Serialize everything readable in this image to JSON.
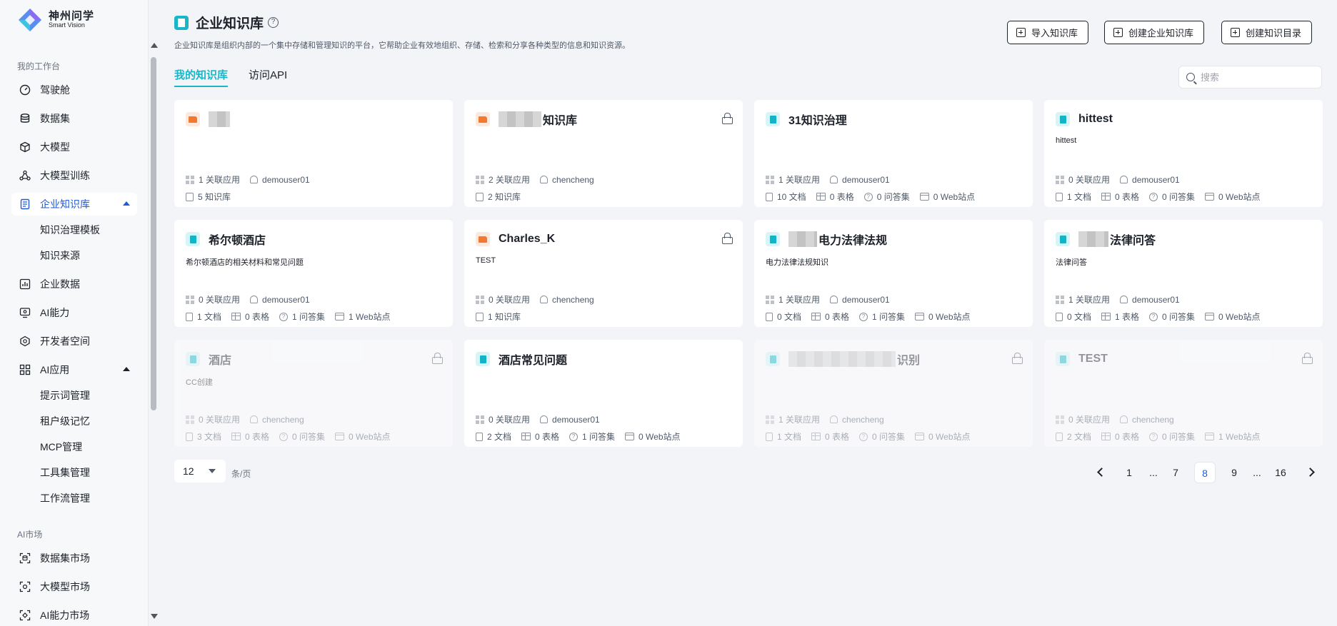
{
  "brand": {
    "name_cn": "神州问学",
    "name_en": "Smart Vision"
  },
  "sidebar": {
    "group_workspace": "我的工作台",
    "items": [
      {
        "label": "驾驶舱",
        "icon": "dashboard-icon"
      },
      {
        "label": "数据集",
        "icon": "database-icon"
      },
      {
        "label": "大模型",
        "icon": "cube-icon"
      },
      {
        "label": "大模型训练",
        "icon": "training-icon"
      },
      {
        "label": "企业知识库",
        "icon": "knowledge-icon",
        "active": true
      },
      {
        "label": "企业数据",
        "icon": "chart-icon"
      },
      {
        "label": "AI能力",
        "icon": "ai-monitor-icon"
      },
      {
        "label": "开发者空间",
        "icon": "developer-icon"
      },
      {
        "label": "AI应用",
        "icon": "grid-icon"
      }
    ],
    "knowledge_sub": [
      "知识治理模板",
      "知识来源"
    ],
    "app_sub": [
      "提示词管理",
      "租户级记忆",
      "MCP管理",
      "工具集管理",
      "工作流管理"
    ],
    "group_market": "AI市场",
    "market_items": [
      "数据集市场",
      "大模型市场",
      "AI能力市场"
    ]
  },
  "header": {
    "title": "企业知识库",
    "help": "?",
    "description": "企业知识库是组织内部的一个集中存储和管理知识的平台，它帮助企业有效地组织、存储、检索和分享各种类型的信息和知识资源。",
    "buttons": {
      "import": "导入知识库",
      "create_kb": "创建企业知识库",
      "create_dir": "创建知识目录"
    }
  },
  "tabs": {
    "mine": "我的知识库",
    "api": "访问API"
  },
  "search": {
    "placeholder": "搜索"
  },
  "cards": [
    {
      "title": "",
      "desc": "",
      "apps": "1 关联应用",
      "owner": "demouser01",
      "docs": "",
      "tables": "",
      "qa": "",
      "web": "",
      "kb": "5 知识库"
    },
    {
      "title": "知识库",
      "desc": "",
      "apps": "2 关联应用",
      "owner": "chencheng",
      "docs": "",
      "tables": "",
      "qa": "",
      "web": "",
      "kb": "2 知识库"
    },
    {
      "title": "31知识治理",
      "desc": "",
      "apps": "1 关联应用",
      "owner": "demouser01",
      "docs": "10 文档",
      "tables": "0 表格",
      "qa": "0 问答集",
      "web": "0 Web站点",
      "kb": ""
    },
    {
      "title": "hittest",
      "desc": "hittest",
      "apps": "0 关联应用",
      "owner": "demouser01",
      "docs": "1 文档",
      "tables": "0 表格",
      "qa": "0 问答集",
      "web": "0 Web站点",
      "kb": ""
    },
    {
      "title": "希尔顿酒店",
      "desc": "希尔顿酒店的相关材料和常见问题",
      "apps": "0 关联应用",
      "owner": "demouser01",
      "docs": "1 文档",
      "tables": "0 表格",
      "qa": "1 问答集",
      "web": "1 Web站点",
      "kb": ""
    },
    {
      "title": "Charles_K",
      "desc": "TEST",
      "apps": "0 关联应用",
      "owner": "chencheng",
      "docs": "",
      "tables": "",
      "qa": "",
      "web": "",
      "kb": "1 知识库"
    },
    {
      "title": "电力法律法规",
      "desc": "电力法律法规知识",
      "apps": "1 关联应用",
      "owner": "demouser01",
      "docs": "0 文档",
      "tables": "0 表格",
      "qa": "1 问答集",
      "web": "0 Web站点",
      "kb": ""
    },
    {
      "title": "法律问答",
      "desc": "法律问答",
      "apps": "1 关联应用",
      "owner": "demouser01",
      "docs": "0 文档",
      "tables": "1 表格",
      "qa": "0 问答集",
      "web": "0 Web站点",
      "kb": ""
    },
    {
      "title": "酒店",
      "desc": "CC创建",
      "apps": "0 关联应用",
      "owner": "chencheng",
      "docs": "3 文档",
      "tables": "0 表格",
      "qa": "0 问答集",
      "web": "0 Web站点",
      "kb": ""
    },
    {
      "title": "酒店常见问题",
      "desc": "",
      "apps": "0 关联应用",
      "owner": "demouser01",
      "docs": "2 文档",
      "tables": "0 表格",
      "qa": "1 问答集",
      "web": "0 Web站点",
      "kb": ""
    },
    {
      "title": "识别",
      "desc": "",
      "apps": "1 关联应用",
      "owner": "chencheng",
      "docs": "1 文档",
      "tables": "0 表格",
      "qa": "0 问答集",
      "web": "0 Web站点",
      "kb": ""
    },
    {
      "title": "TEST",
      "desc": "",
      "apps": "0 关联应用",
      "owner": "chencheng",
      "docs": "2 文档",
      "tables": "0 表格",
      "qa": "0 问答集",
      "web": "1 Web站点",
      "kb": ""
    }
  ],
  "pagination": {
    "page_size": "12",
    "per_page_label": "条/页",
    "pages": [
      "1",
      "...",
      "7",
      "8",
      "9",
      "...",
      "16"
    ],
    "current": "8"
  },
  "colors": {
    "accent": "#1ab6c8",
    "active_blue": "#1f5bd8",
    "folder": "#f2792f"
  }
}
